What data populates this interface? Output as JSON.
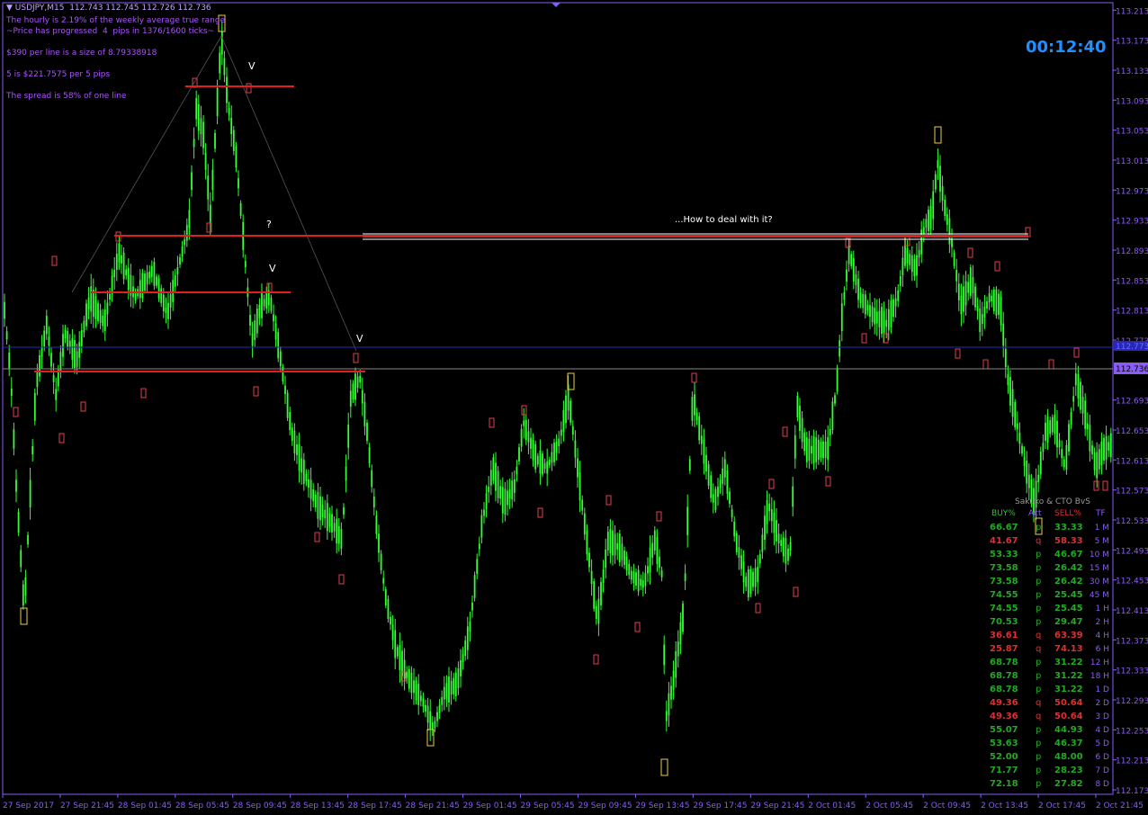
{
  "header": {
    "symbol_line": "USDJPY,M15  112.743 112.745 112.726 112.736",
    "info_lines": [
      "The hourly is 2.19% of the weekly average true range",
      "~Price has progressed  4  pips in 1376/1600 ticks~",
      "$390 per line is a size of 8.79338918",
      "5 is $221.7575 per 5 pips",
      "The spread is 58% of one line"
    ],
    "countdown": "00:12:40"
  },
  "annotations": {
    "question": "...How to deal with it?",
    "q_mark": "?",
    "v_marks": [
      "V",
      "V",
      "V"
    ]
  },
  "chart_data": {
    "type": "candlestick",
    "title": "USDJPY,M15",
    "timeframe": "M15",
    "current_price": 112.736,
    "price_ticks": [
      "113.213",
      "113.173",
      "113.133",
      "113.093",
      "113.053",
      "113.013",
      "112.973",
      "112.933",
      "112.893",
      "112.853",
      "112.813",
      "112.773",
      "112.736",
      "112.693",
      "112.653",
      "112.613",
      "112.573",
      "112.533",
      "112.493",
      "112.453",
      "112.413",
      "112.373",
      "112.333",
      "112.293",
      "112.253",
      "112.213",
      "112.173"
    ],
    "time_ticks": [
      "27 Sep 2017",
      "27 Sep 21:45",
      "28 Sep 01:45",
      "28 Sep 05:45",
      "28 Sep 09:45",
      "28 Sep 13:45",
      "28 Sep 17:45",
      "28 Sep 21:45",
      "29 Sep 01:45",
      "29 Sep 05:45",
      "29 Sep 09:45",
      "29 Sep 13:45",
      "29 Sep 17:45",
      "29 Sep 21:45",
      "2 Oct 01:45",
      "2 Oct 05:45",
      "2 Oct 09:45",
      "2 Oct 13:45",
      "2 Oct 17:45",
      "2 Oct 21:45"
    ],
    "ylim": [
      112.17,
      113.225
    ],
    "horizontal_levels": [
      {
        "price": 113.1,
        "color": "#e02020"
      },
      {
        "price": 112.915,
        "color": "#e02020"
      },
      {
        "price": 112.837,
        "color": "#e02020"
      },
      {
        "price": 112.735,
        "color": "#e02020"
      },
      {
        "price": 112.92,
        "color": "#e02020"
      },
      {
        "price": 112.763,
        "color": "#3030d0"
      }
    ],
    "line_color": "#33ff33"
  },
  "panel": {
    "title": "Sakuko & CTO BvS",
    "headers": [
      "BUY%",
      "Act",
      "SELL%",
      "TF"
    ],
    "rows": [
      {
        "buy": "66.67",
        "act": "p",
        "sell": "33.33",
        "tf": "1 M",
        "dir": "up"
      },
      {
        "buy": "41.67",
        "act": "q",
        "sell": "58.33",
        "tf": "5 M",
        "dir": "down"
      },
      {
        "buy": "53.33",
        "act": "p",
        "sell": "46.67",
        "tf": "10 M",
        "dir": "up"
      },
      {
        "buy": "73.58",
        "act": "p",
        "sell": "26.42",
        "tf": "15 M",
        "dir": "up"
      },
      {
        "buy": "73.58",
        "act": "p",
        "sell": "26.42",
        "tf": "30 M",
        "dir": "up"
      },
      {
        "buy": "74.55",
        "act": "p",
        "sell": "25.45",
        "tf": "45 M",
        "dir": "up"
      },
      {
        "buy": "74.55",
        "act": "p",
        "sell": "25.45",
        "tf": "1 H",
        "dir": "up"
      },
      {
        "buy": "70.53",
        "act": "p",
        "sell": "29.47",
        "tf": "2 H",
        "dir": "up"
      },
      {
        "buy": "36.61",
        "act": "q",
        "sell": "63.39",
        "tf": "4 H",
        "dir": "down"
      },
      {
        "buy": "25.87",
        "act": "q",
        "sell": "74.13",
        "tf": "6 H",
        "dir": "down"
      },
      {
        "buy": "68.78",
        "act": "p",
        "sell": "31.22",
        "tf": "12 H",
        "dir": "up"
      },
      {
        "buy": "68.78",
        "act": "p",
        "sell": "31.22",
        "tf": "18 H",
        "dir": "up"
      },
      {
        "buy": "68.78",
        "act": "p",
        "sell": "31.22",
        "tf": "1 D",
        "dir": "up"
      },
      {
        "buy": "49.36",
        "act": "q",
        "sell": "50.64",
        "tf": "2 D",
        "dir": "down"
      },
      {
        "buy": "49.36",
        "act": "q",
        "sell": "50.64",
        "tf": "3 D",
        "dir": "down"
      },
      {
        "buy": "55.07",
        "act": "p",
        "sell": "44.93",
        "tf": "4 D",
        "dir": "up"
      },
      {
        "buy": "53.63",
        "act": "p",
        "sell": "46.37",
        "tf": "5 D",
        "dir": "up"
      },
      {
        "buy": "52.00",
        "act": "p",
        "sell": "48.00",
        "tf": "6 D",
        "dir": "up"
      },
      {
        "buy": "71.77",
        "act": "p",
        "sell": "28.23",
        "tf": "7 D",
        "dir": "up"
      },
      {
        "buy": "72.18",
        "act": "p",
        "sell": "27.82",
        "tf": "8 D",
        "dir": "up"
      }
    ],
    "colors": {
      "up": "#22aa22",
      "down": "#dd3030",
      "title": "#999999",
      "buy_header": "#22cc22",
      "sell_header": "#dd3030",
      "act_header": "#8a5cf6",
      "tf": "#8a5cf6"
    }
  }
}
